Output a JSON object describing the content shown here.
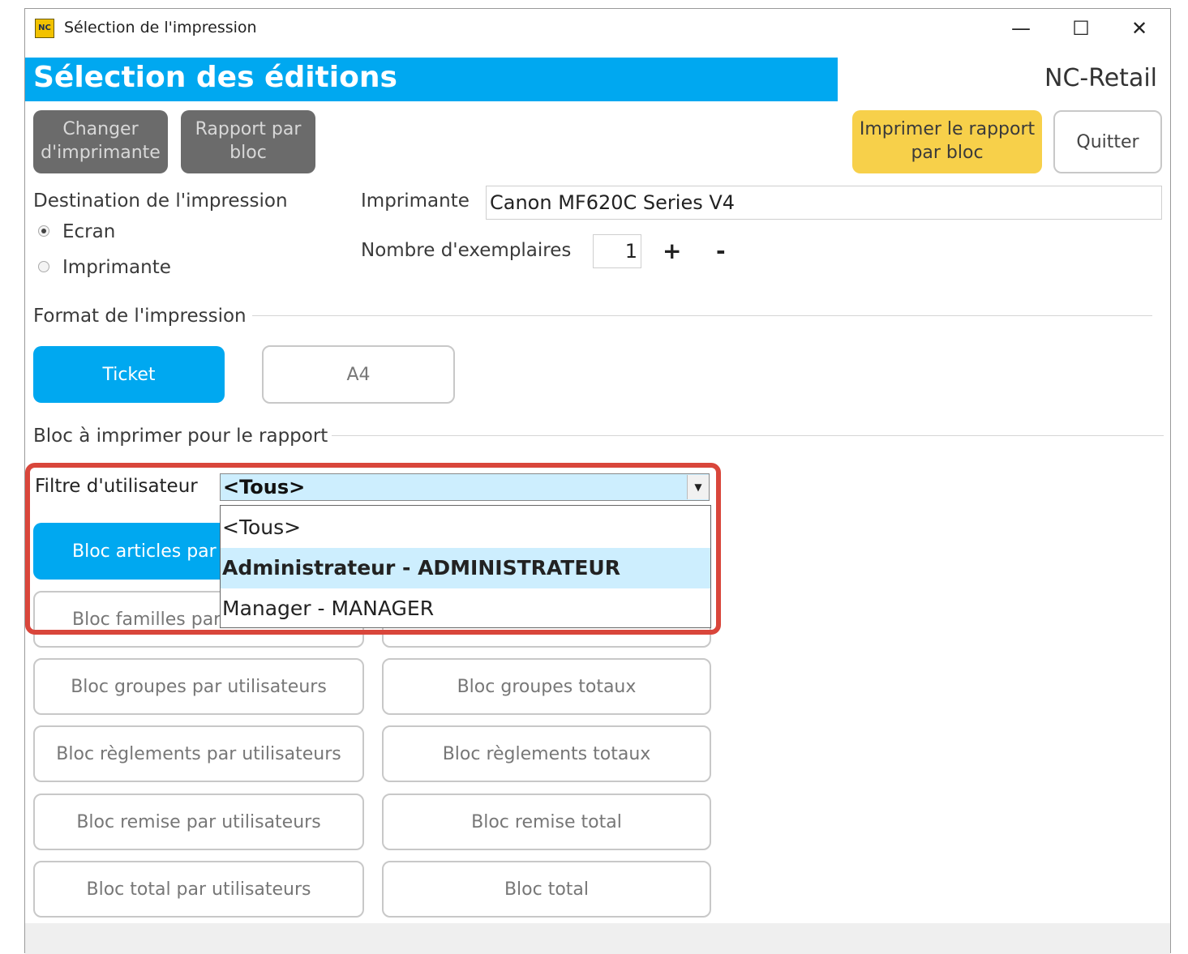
{
  "window": {
    "title": "Sélection de l'impression",
    "icon_label": "NC",
    "controls": {
      "minimize": "—",
      "maximize": "☐",
      "close": "✕"
    }
  },
  "banner": {
    "title": "Sélection des éditions",
    "brand": "NC-Retail"
  },
  "toolbar": {
    "change_printer": "Changer d'imprimante",
    "report_by_block": "Rapport par bloc",
    "print_report": "Imprimer le rapport par bloc",
    "quit": "Quitter"
  },
  "destination": {
    "label": "Destination de l'impression",
    "options": [
      {
        "label": "Ecran",
        "selected": true
      },
      {
        "label": "Imprimante",
        "selected": false
      }
    ]
  },
  "printer": {
    "label": "Imprimante",
    "value": "Canon MF620C Series V4"
  },
  "copies": {
    "label": "Nombre d'exemplaires",
    "value": "1",
    "plus": "+",
    "minus": "-"
  },
  "format": {
    "label": "Format de l'impression",
    "ticket": "Ticket",
    "a4": "A4"
  },
  "blocks": {
    "label": "Bloc à imprimer pour le rapport",
    "filter_label": "Filtre d'utilisateur",
    "filter_value": "<Tous>",
    "filter_options": [
      "<Tous>",
      "Administrateur - ADMINISTRATEUR",
      "Manager - MANAGER"
    ],
    "left": [
      "Bloc articles par",
      "Bloc familles par",
      "Bloc groupes par utilisateurs",
      "Bloc règlements par utilisateurs",
      "Bloc remise par utilisateurs",
      "Bloc total par utilisateurs"
    ],
    "right": [
      "Bloc groupes totaux",
      "Bloc règlements totaux",
      "Bloc remise total",
      "Bloc total"
    ]
  },
  "colors": {
    "accent": "#00a8f0",
    "yellow": "#f7d04a",
    "highlight": "#d9463b",
    "dark_button": "#6b6b6b"
  }
}
